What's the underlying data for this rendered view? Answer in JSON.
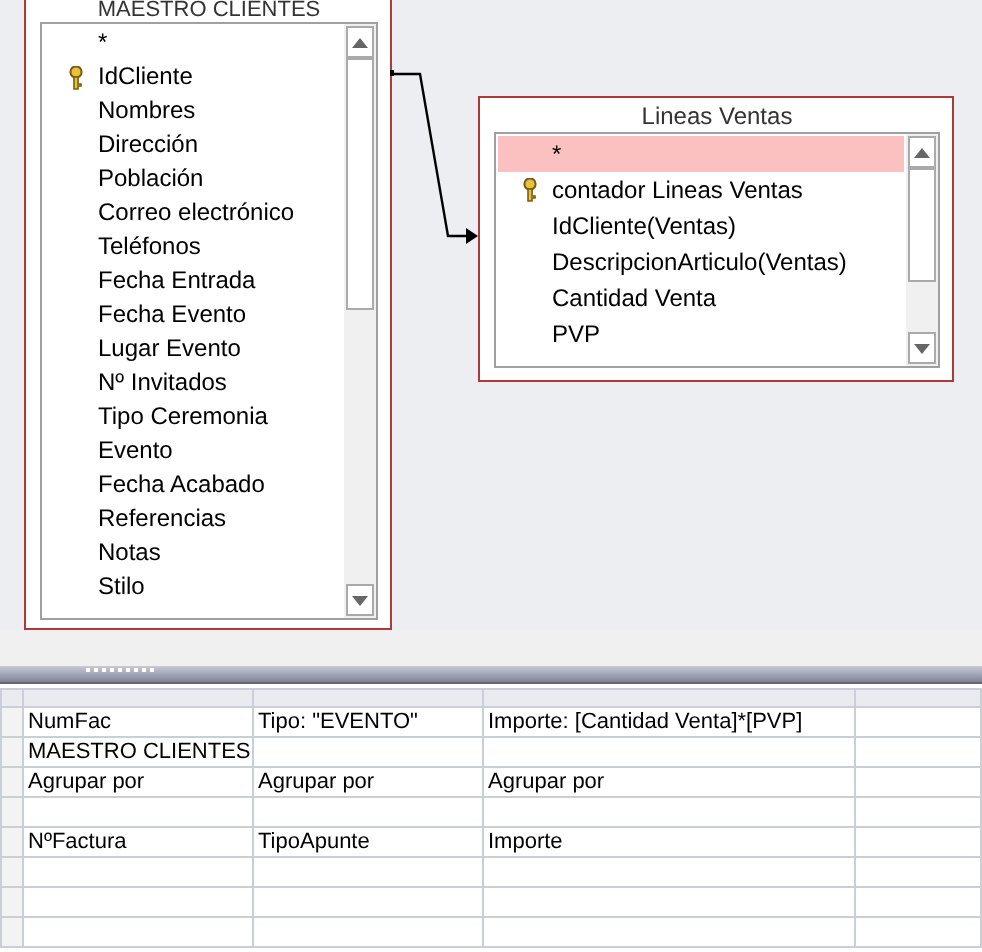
{
  "tables": [
    {
      "title": "MAESTRO CLIENTES",
      "fields": [
        {
          "name": "*",
          "key": false,
          "selected": false
        },
        {
          "name": "IdCliente",
          "key": true,
          "selected": false
        },
        {
          "name": "Nombres",
          "key": false,
          "selected": false
        },
        {
          "name": "Dirección",
          "key": false,
          "selected": false
        },
        {
          "name": "Población",
          "key": false,
          "selected": false
        },
        {
          "name": "Correo electrónico",
          "key": false,
          "selected": false
        },
        {
          "name": "Teléfonos",
          "key": false,
          "selected": false
        },
        {
          "name": "Fecha Entrada",
          "key": false,
          "selected": false
        },
        {
          "name": "Fecha Evento",
          "key": false,
          "selected": false
        },
        {
          "name": "Lugar Evento",
          "key": false,
          "selected": false
        },
        {
          "name": "Nº Invitados",
          "key": false,
          "selected": false
        },
        {
          "name": "Tipo Ceremonia",
          "key": false,
          "selected": false
        },
        {
          "name": "Evento",
          "key": false,
          "selected": false
        },
        {
          "name": "Fecha Acabado",
          "key": false,
          "selected": false
        },
        {
          "name": "Referencias",
          "key": false,
          "selected": false
        },
        {
          "name": "Notas",
          "key": false,
          "selected": false
        },
        {
          "name": "Stilo",
          "key": false,
          "selected": false
        }
      ]
    },
    {
      "title": "Lineas Ventas",
      "fields": [
        {
          "name": "*",
          "key": false,
          "selected": true
        },
        {
          "name": "contador Lineas Ventas",
          "key": true,
          "selected": false
        },
        {
          "name": "IdCliente(Ventas)",
          "key": false,
          "selected": false
        },
        {
          "name": "DescripcionArticulo(Ventas)",
          "key": false,
          "selected": false
        },
        {
          "name": "Cantidad Venta",
          "key": false,
          "selected": false
        },
        {
          "name": "PVP",
          "key": false,
          "selected": false
        }
      ]
    }
  ],
  "grid": {
    "columns": [
      {
        "field": "NumFac",
        "table": "MAESTRO CLIENTES",
        "total": "Agrupar por",
        "alias": "NºFactura"
      },
      {
        "field": "Tipo: \"EVENTO\"",
        "total": "Agrupar por",
        "alias": "TipoApunte"
      },
      {
        "field": "Importe: [Cantidad Venta]*[PVP]",
        "total": "Agrupar por",
        "alias": "Importe"
      }
    ]
  }
}
